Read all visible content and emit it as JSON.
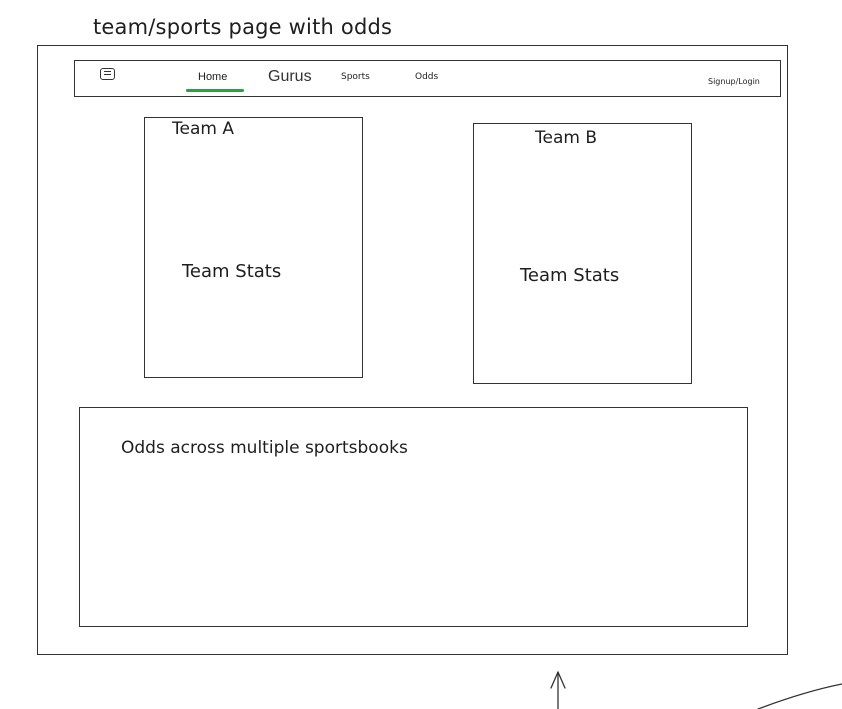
{
  "page_title": "team/sports page with odds",
  "navbar": {
    "menu_icon": "menu-icon",
    "items": [
      {
        "label": "Home",
        "active": true
      },
      {
        "label": "Gurus"
      },
      {
        "label": "Sports"
      },
      {
        "label": "Odds"
      }
    ],
    "account_link": "Signup/Login",
    "active_underline_color": "#2f9e44"
  },
  "team_a": {
    "name": "Team A",
    "stats_label": "Team Stats"
  },
  "team_b": {
    "name": "Team B",
    "stats_label": "Team Stats"
  },
  "odds_panel": {
    "label": "Odds across multiple sportsbooks"
  }
}
